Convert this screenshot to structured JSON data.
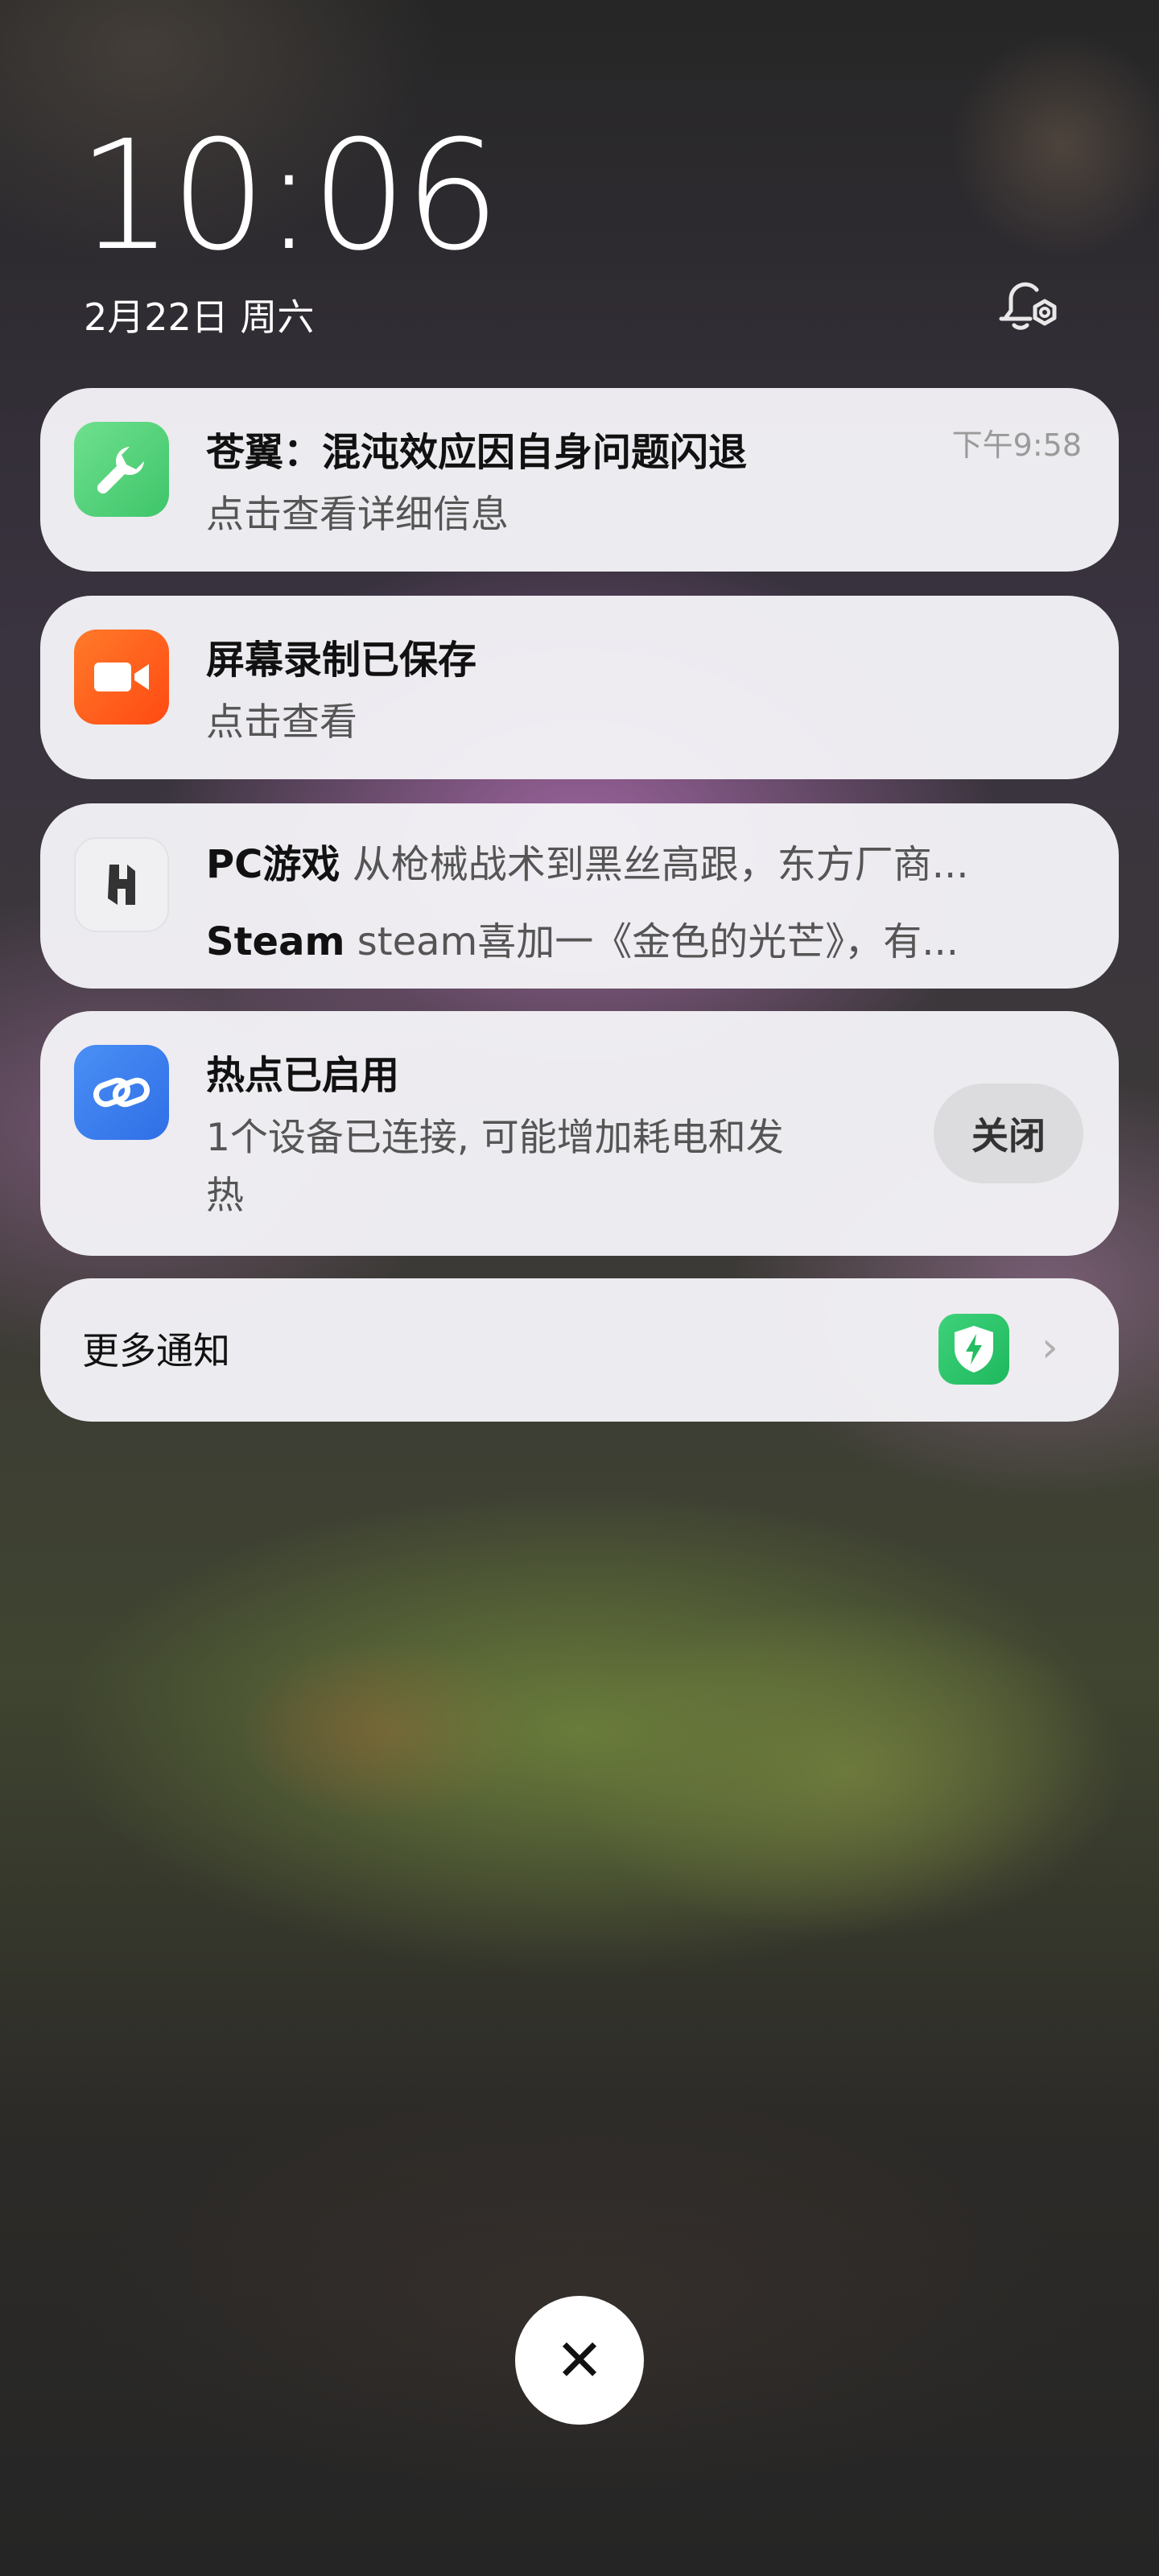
{
  "lockscreen": {
    "time": "10:06",
    "date": "2月22日 周六"
  },
  "notifications": [
    {
      "icon": "wrench-icon",
      "icon_color": "#4cd07a",
      "title": "苍翼：混沌效应因自身问题闪退",
      "text": "点击查看详细信息",
      "time": "下午9:58"
    },
    {
      "icon": "video-camera-icon",
      "icon_color": "#ff5a1f",
      "title": "屏幕录制已保存",
      "text": "点击查看"
    },
    {
      "icon": "game-center-icon",
      "icon_color": "#f2f2f4",
      "lines": [
        {
          "sender": "PC游戏",
          "text": "从枪械战术到黑丝高跟，东方厂商..."
        },
        {
          "sender": "Steam",
          "text": "steam喜加一《金色的光芒》，有..."
        }
      ]
    },
    {
      "icon": "link-icon",
      "icon_color": "#3a7ff0",
      "title": "热点已启用",
      "text_line1": "1个设备已连接, 可能增加耗电和发",
      "text_line2": "热",
      "action": "关闭"
    }
  ],
  "more": {
    "label": "更多通知",
    "icon": "shield-lightning-icon"
  },
  "dismiss": {
    "icon": "close-icon",
    "glyph": "✕"
  }
}
